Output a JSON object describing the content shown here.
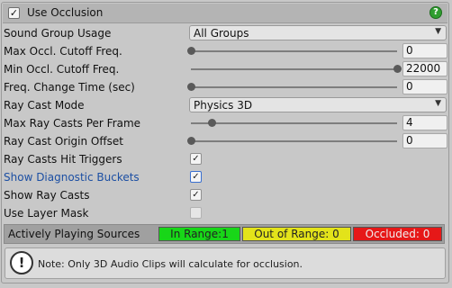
{
  "header": {
    "title": "Use Occlusion",
    "checked_glyph": "✓",
    "help_glyph": "?",
    "help_icon": "help-icon"
  },
  "rows": {
    "sound_group_usage": {
      "label": "Sound Group Usage",
      "value": "All Groups"
    },
    "max_cutoff": {
      "label": "Max Occl. Cutoff Freq.",
      "value": "0",
      "fraction": 0.0
    },
    "min_cutoff": {
      "label": "Min Occl. Cutoff Freq.",
      "value": "22000",
      "fraction": 1.0
    },
    "freq_change_time": {
      "label": "Freq. Change Time (sec)",
      "value": "0",
      "fraction": 0.0
    },
    "ray_cast_mode": {
      "label": "Ray Cast Mode",
      "value": "Physics 3D"
    },
    "max_ray_casts": {
      "label": "Max Ray Casts Per Frame",
      "value": "4",
      "fraction": 0.1
    },
    "ray_origin_offset": {
      "label": "Ray Cast Origin Offset",
      "value": "0",
      "fraction": 0.0
    },
    "hit_triggers": {
      "label": "Ray Casts Hit Triggers",
      "checked": true,
      "glyph": "✓"
    },
    "diagnostic_buckets": {
      "label": "Show Diagnostic Buckets",
      "checked": true,
      "glyph": "✓"
    },
    "show_ray_casts": {
      "label": "Show Ray Casts",
      "checked": true,
      "glyph": "✓"
    },
    "use_layer_mask": {
      "label": "Use Layer Mask",
      "checked": false,
      "glyph": ""
    }
  },
  "dropdown_arrow": "▼",
  "sources": {
    "title": "Actively Playing Sources",
    "in_range": "In Range:1",
    "out_of_range": "Out of Range: 0",
    "occluded": "Occluded: 0"
  },
  "note": {
    "icon_glyph": "!",
    "icon": "warning-icon",
    "text": "Note: Only 3D Audio Clips will calculate for occlusion."
  },
  "colors": {
    "in_range": "#18d618",
    "out_of_range": "#e3e31a",
    "occluded": "#e61818",
    "help_icon": "#2f9e2f"
  }
}
